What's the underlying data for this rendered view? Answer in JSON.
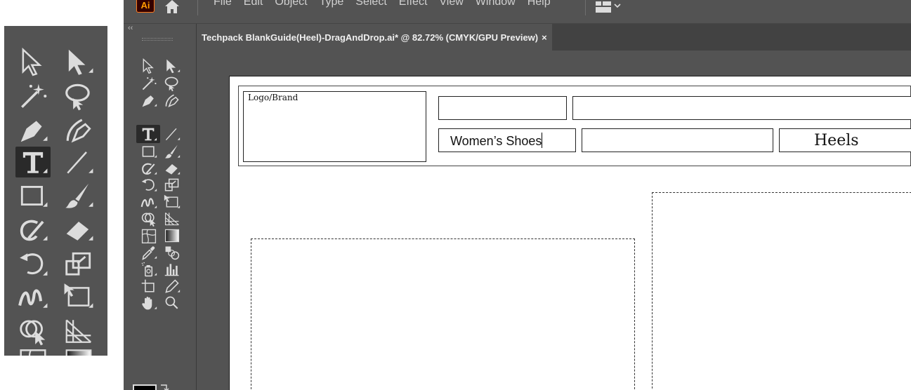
{
  "menubar": {
    "app_logo": "Ai",
    "menu_items": [
      "File",
      "Edit",
      "Object",
      "Type",
      "Select",
      "Effect",
      "View",
      "Window",
      "Help"
    ]
  },
  "document_tab": {
    "title": "Techpack BlankGuide(Heel)-DragAndDrop.ai* @ 82.72% (CMYK/GPU Preview)",
    "close": "×"
  },
  "toolbar": {
    "collapse": "‹‹",
    "active_tool": "type-tool",
    "tools": [
      "selection-tool-icon",
      "direct-selection-tool-icon",
      "magic-wand-tool-icon",
      "lasso-tool-icon",
      "pen-tool-icon",
      "curvature-tool-icon",
      "type-tool-icon",
      "line-segment-tool-icon",
      "rectangle-tool-icon",
      "paintbrush-tool-icon",
      "shaper-tool-icon",
      "eraser-tool-icon",
      "rotate-tool-icon",
      "scale-tool-icon",
      "warp-tool-icon",
      "free-transform-tool-icon",
      "shape-builder-tool-icon",
      "perspective-grid-tool-icon",
      "mesh-tool-icon",
      "gradient-tool-icon",
      "eyedropper-tool-icon",
      "blend-tool-icon",
      "symbol-sprayer-tool-icon",
      "column-graph-tool-icon",
      "artboard-tool-icon",
      "slice-tool-icon",
      "hand-tool-icon",
      "zoom-tool-icon"
    ],
    "colors": {
      "fill": "#000000"
    }
  },
  "artboard": {
    "logo_label": "Logo/Brand",
    "category_value": "Women’s Shoes",
    "style_value": "Heels"
  },
  "colors": {
    "ui_background": "#535353",
    "tab_bar": "#424242",
    "active_tool": "#2a2a2a",
    "icon": "#dcdcdc",
    "accent": "#ff9a00"
  }
}
